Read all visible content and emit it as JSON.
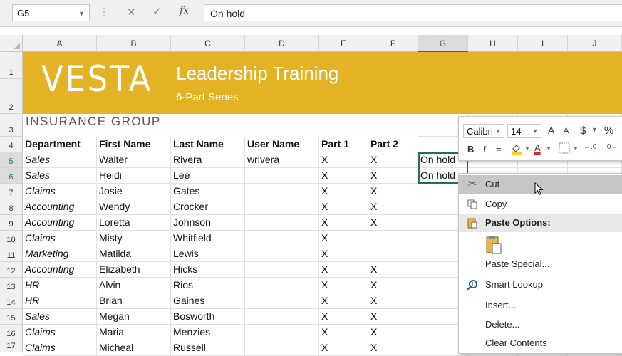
{
  "formula_bar": {
    "name_box": "G5",
    "formula_value": "On hold",
    "fx_label": "fx",
    "cancel_glyph": "✕",
    "enter_glyph": "✓"
  },
  "columns": [
    "A",
    "B",
    "C",
    "D",
    "E",
    "F",
    "G",
    "H",
    "I",
    "J"
  ],
  "rows": [
    "1",
    "2",
    "3",
    "4",
    "5",
    "6",
    "7",
    "8",
    "9",
    "10",
    "11",
    "12",
    "13",
    "14",
    "15",
    "16",
    "17"
  ],
  "banner": {
    "logo": "VESTA",
    "title": "Leadership Training",
    "subtitle": "6-Part Series",
    "company": "INSURANCE  GROUP",
    "color": "#e4b325"
  },
  "table": {
    "headers": [
      "Department",
      "First Name",
      "Last Name",
      "User Name",
      "Part 1",
      "Part 2"
    ],
    "rows": [
      [
        "Sales",
        "Walter",
        "Rivera",
        "wrivera",
        "X",
        "X",
        "On hold"
      ],
      [
        "Sales",
        "Heidi",
        "Lee",
        "",
        "X",
        "X",
        "On hold"
      ],
      [
        "Claims",
        "Josie",
        "Gates",
        "",
        "X",
        "X",
        ""
      ],
      [
        "Accounting",
        "Wendy",
        "Crocker",
        "",
        "X",
        "X",
        ""
      ],
      [
        "Accounting",
        "Loretta",
        "Johnson",
        "",
        "X",
        "X",
        ""
      ],
      [
        "Claims",
        "Misty",
        "Whitfield",
        "",
        "X",
        "",
        ""
      ],
      [
        "Marketing",
        "Matilda",
        "Lewis",
        "",
        "X",
        "",
        ""
      ],
      [
        "Accounting",
        "Elizabeth",
        "Hicks",
        "",
        "X",
        "X",
        ""
      ],
      [
        "HR",
        "Alvin",
        "Rios",
        "",
        "X",
        "X",
        ""
      ],
      [
        "HR",
        "Brian",
        "Gaines",
        "",
        "X",
        "X",
        ""
      ],
      [
        "Sales",
        "Megan",
        "Bosworth",
        "",
        "X",
        "X",
        ""
      ],
      [
        "Claims",
        "Maria",
        "Menzies",
        "",
        "X",
        "X",
        ""
      ],
      [
        "Claims",
        "Micheal",
        "Russell",
        "",
        "X",
        "X",
        ""
      ]
    ]
  },
  "mini_toolbar": {
    "font": "Calibri",
    "size": "14",
    "grow": "A",
    "shrink": "A",
    "currency": "$",
    "percent": "%",
    "bold": "B",
    "italic": "I",
    "font_color": "A"
  },
  "context_menu": {
    "items": [
      {
        "label": "Cut",
        "icon": "scissors-icon"
      },
      {
        "label": "Copy",
        "icon": "copy-icon"
      },
      {
        "label": "Paste Options:",
        "icon": "paste-icon"
      },
      {
        "label": "Paste Special...",
        "icon": ""
      },
      {
        "label": "Smart Lookup",
        "icon": "search-icon"
      },
      {
        "label": "Insert...",
        "icon": ""
      },
      {
        "label": "Delete...",
        "icon": ""
      },
      {
        "label": "Clear Contents",
        "icon": ""
      }
    ]
  },
  "colors": {
    "accent": "#217346",
    "banner": "#e4b325"
  }
}
